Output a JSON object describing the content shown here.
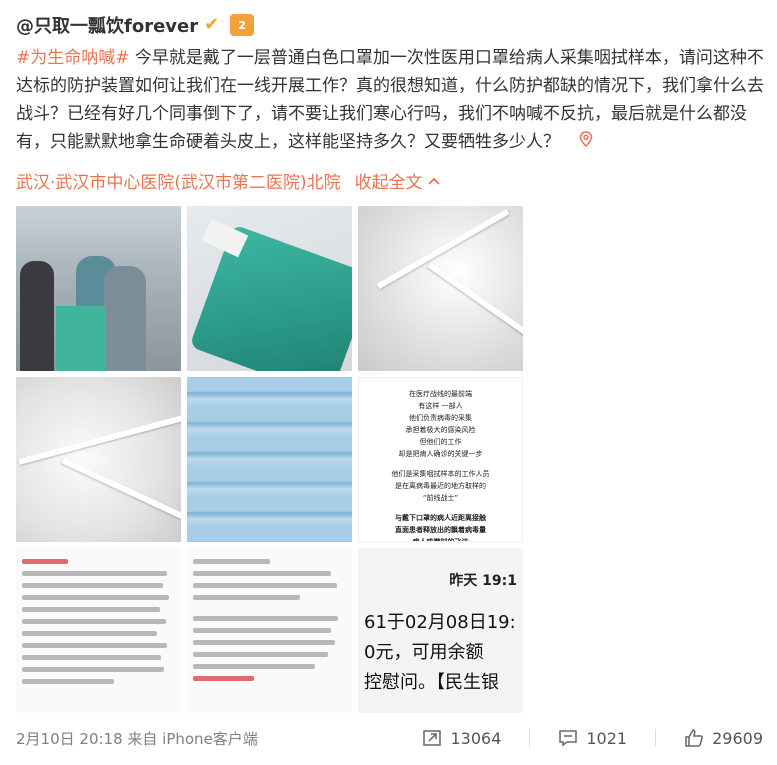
{
  "author": {
    "name": "@只取一瓢饮forever",
    "member_level": "2"
  },
  "post": {
    "hashtag": "#为生命呐喊#",
    "text": " 今早就是戴了一层普通白色口罩加一次性医用口罩给病人采集咽拭样本，请问这种不达标的防护装置如何让我们在一线开展工作？真的很想知道，什么防护都缺的情况下，我们拿什么去战斗？已经有好几个同事倒下了，请不要让我们寒心行吗，我们不呐喊不反抗，最后就是什么都没有，只能默默地拿生命硬着头皮上，这样能坚持多久？又要牺牲多少人？",
    "location": "武汉·武汉市中心医院(武汉市第二医院)北院",
    "collapse_label": "收起全文"
  },
  "images": {
    "poster_lines": [
      "在医疗战线的最前端",
      "有这样 一部人",
      "他们负责病毒的采集",
      "承担着极大的感染风险",
      "但他们的工作",
      "却是把病人确诊的关键一步",
      "",
      "他们是采集咽拭样本的工作人员",
      "是在离病毒最近的地方取样的",
      "“前线战士”",
      "",
      "与戴下口罩的病人近距离接触",
      "直面患者释放出的飘着病毒量",
      "病人咳嗽时的飞沫"
    ],
    "sms_time": "昨天 19:1",
    "sms_lines": [
      "61于02月08日19:",
      "0元，可用余额",
      "控慰问。【民生银"
    ]
  },
  "footer": {
    "timestamp": "2月10日 20:18 来自 iPhone客户端",
    "repost_count": "13064",
    "comment_count": "1021",
    "like_count": "29609"
  },
  "colors": {
    "accent": "#eb7350",
    "text": "#333333",
    "muted": "#808080"
  }
}
